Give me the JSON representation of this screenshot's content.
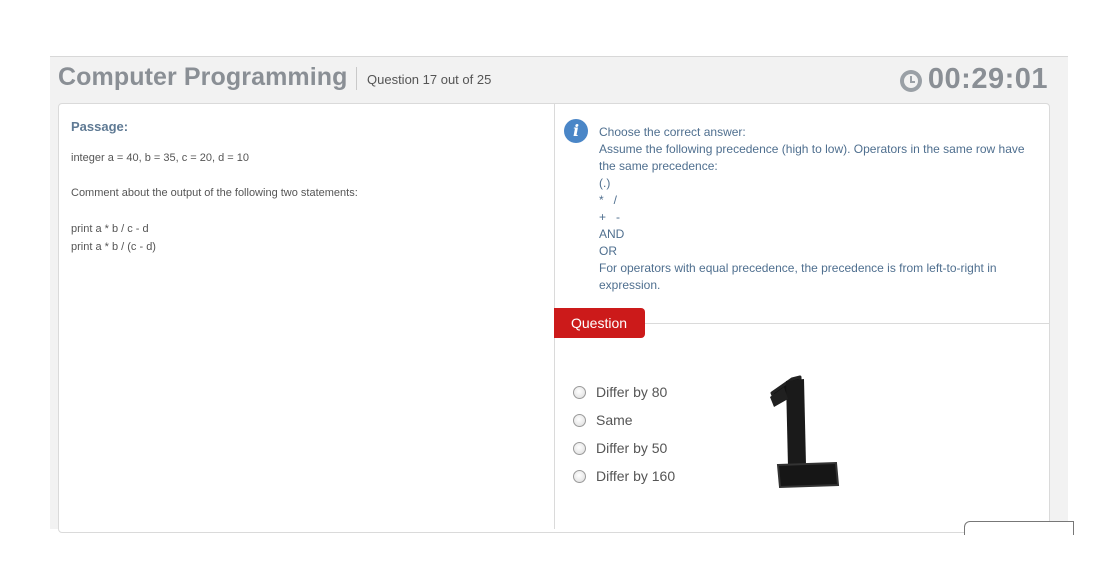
{
  "header": {
    "title": "Computer Programming",
    "question_counter": "Question 17 out of 25",
    "timer": "00:29:01",
    "timer_icon": "clock-icon"
  },
  "passage": {
    "label": "Passage:",
    "lines": [
      "integer a = 40, b = 35, c = 20, d = 10",
      "Comment about the output of the following two statements:",
      "print a * b / c - d",
      "print a * b / (c - d)"
    ]
  },
  "instructions": {
    "icon": "info-icon",
    "lines": [
      "Choose the correct answer:",
      "Assume the following precedence (high to low). Operators in the same row have the same precedence:",
      "(.)",
      "*   /",
      "+   -",
      "AND",
      "OR",
      "For operators with equal precedence, the precedence is from left-to-right in expression."
    ]
  },
  "question": {
    "tab_label": "Question",
    "options": [
      "Differ by 80",
      "Same",
      "Differ by 50",
      "Differ by 160"
    ],
    "handwritten_mark": "1"
  },
  "colors": {
    "accent_red": "#cc1a1a",
    "info_blue": "#4a86c7",
    "instruction_text": "#4f6f8f",
    "header_gray": "#8a8f95"
  }
}
